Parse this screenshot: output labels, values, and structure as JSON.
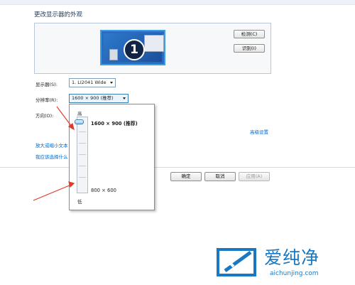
{
  "window": {
    "title": "更改显示器的外观"
  },
  "preview": {
    "monitor_number": "1"
  },
  "buttons": {
    "detect": "检测(C)",
    "identify": "识别(I)",
    "ok": "确定",
    "cancel": "取消",
    "apply": "应用(A)"
  },
  "form": {
    "display_label": "显示器(S):",
    "display_value": "1. LI2041 Wide",
    "resolution_label": "分辨率(R):",
    "resolution_value": "1600 × 900 (推荐)",
    "orientation_label": "方向(O):"
  },
  "links": {
    "advanced": "高级设置",
    "enlarge": "放大或缩小文本",
    "which": "我应该选择什么"
  },
  "resolution_popup": {
    "high_label": "高",
    "low_label": "低",
    "top_option": "1600 × 900 (推荐)",
    "bottom_option": "800 × 600",
    "selected_level": 1.0
  },
  "watermark": {
    "brand": "爱纯净",
    "url": "aichunjing.com"
  },
  "colors": {
    "link": "#0066cc",
    "annotation_arrow": "#e23a2a",
    "brand": "#1a78c2"
  }
}
